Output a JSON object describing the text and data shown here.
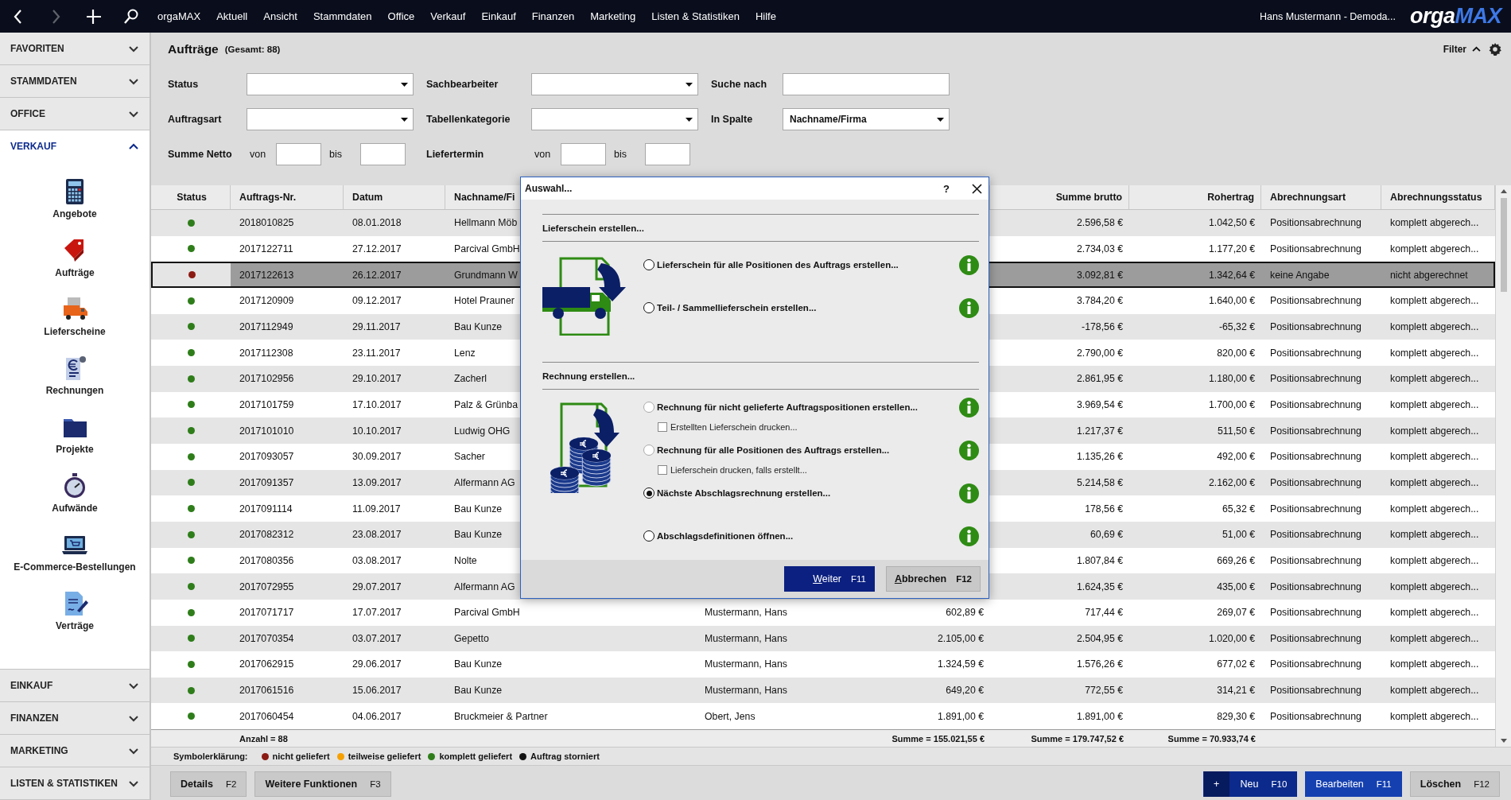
{
  "topbar": {
    "nav": [
      {
        "kind": "back",
        "disabled": false
      },
      {
        "kind": "forward",
        "disabled": true
      },
      {
        "kind": "add",
        "disabled": false
      },
      {
        "kind": "search",
        "disabled": false
      }
    ],
    "menu": [
      "orgaMAX",
      "Aktuell",
      "Ansicht",
      "Stammdaten",
      "Office",
      "Verkauf",
      "Einkauf",
      "Finanzen",
      "Marketing",
      "Listen & Statistiken",
      "Hilfe"
    ],
    "user": "Hans Mustermann - Demoda...",
    "logo": [
      "orga",
      "MAX"
    ]
  },
  "sidebar": {
    "sections": [
      {
        "label": "FAVORITEN",
        "expanded": false
      },
      {
        "label": "STAMMDATEN",
        "expanded": false
      },
      {
        "label": "OFFICE",
        "expanded": false
      },
      {
        "label": "VERKAUF",
        "expanded": true,
        "items": [
          "Angebote",
          "Aufträge",
          "Lieferscheine",
          "Rechnungen",
          "Projekte",
          "Aufwände",
          "E-Commerce-Bestellungen",
          "Verträge"
        ]
      },
      {
        "label": "EINKAUF",
        "expanded": false
      },
      {
        "label": "FINANZEN",
        "expanded": false
      },
      {
        "label": "MARKETING",
        "expanded": false
      },
      {
        "label": "LISTEN & STATISTIKEN",
        "expanded": false
      }
    ]
  },
  "header": {
    "title": "Aufträge",
    "count": "(Gesamt: 88)",
    "filter_toggle": {
      "label": "Filter",
      "expanded": true
    }
  },
  "filters": [
    [
      {
        "kind": "dropdown",
        "label": "Status"
      },
      {
        "kind": "dropdown",
        "label": "Sachbearbeiter"
      },
      {
        "kind": "text",
        "label": "Suche nach"
      }
    ],
    [
      {
        "kind": "dropdown",
        "label": "Auftragsart"
      },
      {
        "kind": "dropdown",
        "label": "Tabellenkategorie"
      },
      {
        "kind": "dropdown",
        "label": "In Spalte",
        "value": "Nachname/Firma"
      }
    ],
    [
      {
        "kind": "range",
        "label": "Summe Netto",
        "from": "von",
        "to": "bis"
      },
      {
        "kind": "range",
        "label": "Liefertermin",
        "from": "von",
        "to": "bis"
      }
    ]
  ],
  "table": {
    "columns": [
      "Status",
      "Auftrags-Nr.",
      "Datum",
      "Nachname/Fi",
      "Summe brutto",
      "Rohertrag",
      "Abrechnungsart",
      "Abrechnungsstatus"
    ],
    "rows": [
      {
        "color": "#2e7d1a",
        "selected": false,
        "auftrags_nr": "2018010825",
        "datum": "08.01.2018",
        "name": "Hellmann Möb",
        "summe_brutto": "2.596,58 €",
        "rohertrag": "1.042,50 €",
        "abrechnungsart": "Positionsabrechnung",
        "abrechnungsstatus": "komplett abgerech..."
      },
      {
        "color": "#2e7d1a",
        "selected": false,
        "auftrags_nr": "2017122711",
        "datum": "27.12.2017",
        "name": "Parcival GmbH",
        "summe_brutto": "2.734,03 €",
        "rohertrag": "1.177,20 €",
        "abrechnungsart": "Positionsabrechnung",
        "abrechnungsstatus": "komplett abgerech..."
      },
      {
        "color": "#8b1a12",
        "selected": true,
        "auftrags_nr": "2017122613",
        "datum": "26.12.2017",
        "name": "Grundmann W",
        "summe_brutto": "3.092,81 €",
        "rohertrag": "1.342,64 €",
        "abrechnungsart": "keine Angabe",
        "abrechnungsstatus": "nicht abgerechnet"
      },
      {
        "color": "#2e7d1a",
        "selected": false,
        "auftrags_nr": "2017120909",
        "datum": "09.12.2017",
        "name": "Hotel Prauner",
        "summe_brutto": "3.784,20 €",
        "rohertrag": "1.640,00 €",
        "abrechnungsart": "Positionsabrechnung",
        "abrechnungsstatus": "komplett abgerech..."
      },
      {
        "color": "#2e7d1a",
        "selected": false,
        "auftrags_nr": "2017112949",
        "datum": "29.11.2017",
        "name": "Bau Kunze",
        "summe_brutto": "-178,56 €",
        "rohertrag": "-65,32 €",
        "abrechnungsart": "Positionsabrechnung",
        "abrechnungsstatus": "komplett abgerech..."
      },
      {
        "color": "#2e7d1a",
        "selected": false,
        "auftrags_nr": "2017112308",
        "datum": "23.11.2017",
        "name": "Lenz",
        "summe_brutto": "2.790,00 €",
        "rohertrag": "820,00 €",
        "abrechnungsart": "Positionsabrechnung",
        "abrechnungsstatus": "komplett abgerech..."
      },
      {
        "color": "#2e7d1a",
        "selected": false,
        "auftrags_nr": "2017102956",
        "datum": "29.10.2017",
        "name": "Zacherl",
        "summe_brutto": "2.861,95 €",
        "rohertrag": "1.180,00 €",
        "abrechnungsart": "Positionsabrechnung",
        "abrechnungsstatus": "komplett abgerech..."
      },
      {
        "color": "#2e7d1a",
        "selected": false,
        "auftrags_nr": "2017101759",
        "datum": "17.10.2017",
        "name": "Palz & Grünba",
        "summe_brutto": "3.969,54 €",
        "rohertrag": "1.700,00 €",
        "abrechnungsart": "Positionsabrechnung",
        "abrechnungsstatus": "komplett abgerech..."
      },
      {
        "color": "#2e7d1a",
        "selected": false,
        "auftrags_nr": "2017101010",
        "datum": "10.10.2017",
        "name": "Ludwig OHG",
        "summe_brutto": "1.217,37 €",
        "rohertrag": "511,50 €",
        "abrechnungsart": "Positionsabrechnung",
        "abrechnungsstatus": "komplett abgerech..."
      },
      {
        "color": "#2e7d1a",
        "selected": false,
        "auftrags_nr": "2017093057",
        "datum": "30.09.2017",
        "name": "Sacher",
        "summe_brutto": "1.135,26 €",
        "rohertrag": "492,00 €",
        "abrechnungsart": "Positionsabrechnung",
        "abrechnungsstatus": "komplett abgerech..."
      },
      {
        "color": "#2e7d1a",
        "selected": false,
        "auftrags_nr": "2017091357",
        "datum": "13.09.2017",
        "name": "Alfermann AG",
        "summe_brutto": "5.214,58 €",
        "rohertrag": "2.162,00 €",
        "abrechnungsart": "Positionsabrechnung",
        "abrechnungsstatus": "komplett abgerech..."
      },
      {
        "color": "#2e7d1a",
        "selected": false,
        "auftrags_nr": "2017091114",
        "datum": "11.09.2017",
        "name": "Bau Kunze",
        "summe_brutto": "178,56 €",
        "rohertrag": "65,32 €",
        "abrechnungsart": "Positionsabrechnung",
        "abrechnungsstatus": "komplett abgerech..."
      },
      {
        "color": "#2e7d1a",
        "selected": false,
        "auftrags_nr": "2017082312",
        "datum": "23.08.2017",
        "name": "Bau Kunze",
        "summe_brutto": "60,69 €",
        "rohertrag": "51,00 €",
        "abrechnungsart": "Positionsabrechnung",
        "abrechnungsstatus": "komplett abgerech..."
      },
      {
        "color": "#2e7d1a",
        "selected": false,
        "auftrags_nr": "2017080356",
        "datum": "03.08.2017",
        "name": "Nolte",
        "summe_brutto": "1.807,84 €",
        "rohertrag": "669,26 €",
        "abrechnungsart": "Positionsabrechnung",
        "abrechnungsstatus": "komplett abgerech..."
      },
      {
        "color": "#2e7d1a",
        "selected": false,
        "auftrags_nr": "2017072955",
        "datum": "29.07.2017",
        "name": "Alfermann AG",
        "summe_brutto": "1.624,35 €",
        "rohertrag": "435,00 €",
        "abrechnungsart": "Positionsabrechnung",
        "abrechnungsstatus": "komplett abgerech..."
      },
      {
        "color": "#2e7d1a",
        "selected": false,
        "auftrags_nr": "2017071717",
        "datum": "17.07.2017",
        "name": "Parcival GmbH",
        "column_5": "Mustermann, Hans",
        "column_6": "602,89 €",
        "summe_brutto": "717,44 €",
        "rohertrag": "269,07 €",
        "abrechnungsart": "Positionsabrechnung",
        "abrechnungsstatus": "komplett abgerech..."
      },
      {
        "color": "#2e7d1a",
        "selected": false,
        "auftrags_nr": "2017070354",
        "datum": "03.07.2017",
        "name": "Gepetto",
        "column_5": "Mustermann, Hans",
        "column_6": "2.105,00 €",
        "summe_brutto": "2.504,95 €",
        "rohertrag": "1.020,00 €",
        "abrechnungsart": "Positionsabrechnung",
        "abrechnungsstatus": "komplett abgerech..."
      },
      {
        "color": "#2e7d1a",
        "selected": false,
        "auftrags_nr": "2017062915",
        "datum": "29.06.2017",
        "name": "Bau Kunze",
        "column_5": "Mustermann, Hans",
        "column_6": "1.324,59 €",
        "summe_brutto": "1.576,26 €",
        "rohertrag": "677,02 €",
        "abrechnungsart": "Positionsabrechnung",
        "abrechnungsstatus": "komplett abgerech..."
      },
      {
        "color": "#2e7d1a",
        "selected": false,
        "auftrags_nr": "2017061516",
        "datum": "15.06.2017",
        "name": "Bau Kunze",
        "column_5": "Mustermann, Hans",
        "column_6": "649,20 €",
        "summe_brutto": "772,55 €",
        "rohertrag": "314,21 €",
        "abrechnungsart": "Positionsabrechnung",
        "abrechnungsstatus": "komplett abgerech..."
      },
      {
        "color": "#2e7d1a",
        "selected": false,
        "auftrags_nr": "2017060454",
        "datum": "04.06.2017",
        "name": "Bruckmeier & Partner",
        "column_5": "Obert, Jens",
        "column_6": "1.891,00 €",
        "summe_brutto": "1.891,00 €",
        "rohertrag": "829,30 €",
        "abrechnungsart": "Positionsabrechnung",
        "abrechnungsstatus": "komplett abgerech..."
      }
    ],
    "footer": {
      "count": "Anzahl = 88",
      "sums": [
        "Summe = 155.021,55 €",
        "Summe = 179.747,52 €",
        "Summe = 70.933,74 €"
      ]
    }
  },
  "legend": {
    "title": "Symbolerklärung:",
    "items": [
      {
        "label": "nicht geliefert",
        "color": "#8b1a12"
      },
      {
        "label": "teilweise geliefert",
        "color": "#f5a000"
      },
      {
        "label": "komplett geliefert",
        "color": "#2e7d1a"
      },
      {
        "label": "Auftrag storniert",
        "color": "#111111"
      }
    ]
  },
  "bottom_bar": {
    "left": [
      {
        "label": "Details",
        "key": "F2"
      },
      {
        "label": "Weitere Funktionen",
        "key": "F3"
      }
    ],
    "right": [
      {
        "kind": "new",
        "icon": "+",
        "label": "Neu",
        "key": "F10"
      },
      {
        "kind": "primary",
        "label": "Bearbeiten",
        "key": "F11"
      },
      {
        "kind": "plain",
        "label": "Löschen",
        "key": "F12"
      }
    ]
  },
  "dialog": {
    "title": "Auswahl...",
    "help": "?",
    "sections": [
      {
        "kind": "delivery",
        "title": "Lieferschein erstellen...",
        "options": [
          {
            "label": "Lieferschein für alle Positionen des Auftrags erstellen...",
            "selected": false,
            "disabled": false
          },
          {
            "label": "Teil- / Sammellieferschein erstellen...",
            "selected": false,
            "disabled": false
          }
        ]
      },
      {
        "kind": "invoice",
        "title": "Rechnung erstellen...",
        "options": [
          {
            "label": "Rechnung für nicht gelieferte Auftragspositionen erstellen...",
            "selected": false,
            "disabled": true,
            "sub_option": {
              "label": "Erstellten Lieferschein drucken...",
              "checked": false
            }
          },
          {
            "label": "Rechnung für alle Positionen des Auftrags erstellen...",
            "selected": false,
            "disabled": true,
            "sub_option": {
              "label": "Lieferschein drucken, falls erstellt...",
              "checked": false
            }
          },
          {
            "label": "Nächste Abschlagsrechnung erstellen...",
            "selected": true,
            "disabled": false
          },
          {
            "label": "Abschlagsdefinitionen öffnen...",
            "selected": false,
            "disabled": false
          }
        ]
      }
    ],
    "buttons": [
      {
        "kind": "primary",
        "label": "Weiter",
        "key": "F11"
      },
      {
        "kind": "plain",
        "label": "Abbrechen",
        "key": "F12"
      }
    ]
  }
}
